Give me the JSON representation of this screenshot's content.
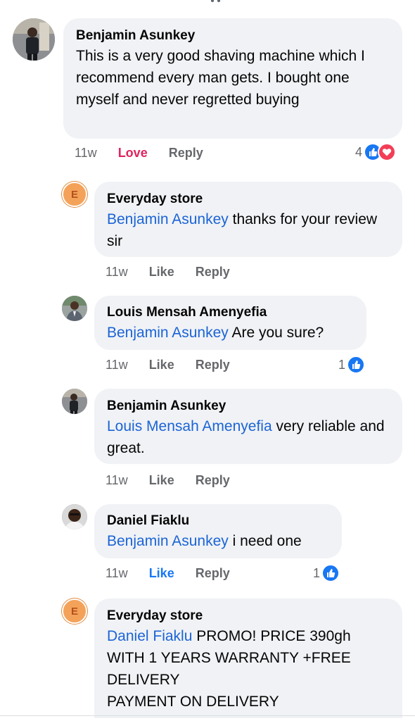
{
  "comments": [
    {
      "author": "Benjamin Asunkey",
      "mention": "",
      "text": "This is a very good shaving machine which I recommend every man gets. I bought one myself and never regretted buying",
      "time": "11w",
      "reaction_label": "Love",
      "reply_label": "Reply",
      "reaction_count": "4",
      "avatar": "photo"
    },
    {
      "author": "Everyday store",
      "mention": "Benjamin Asunkey",
      "text": " thanks for your review sir",
      "time": "11w",
      "reaction_label": "Like",
      "reply_label": "Reply",
      "reaction_count": "",
      "avatar_letter": "E"
    },
    {
      "author": "Louis Mensah Amenyefia",
      "mention": "Benjamin Asunkey",
      "text": " Are you sure?",
      "time": "11w",
      "reaction_label": "Like",
      "reply_label": "Reply",
      "reaction_count": "1",
      "avatar": "photo"
    },
    {
      "author": "Benjamin Asunkey",
      "mention": "Louis Mensah Amenyefia",
      "text": " very reliable and great.",
      "time": "11w",
      "reaction_label": "Like",
      "reply_label": "Reply",
      "reaction_count": "",
      "avatar": "photo"
    },
    {
      "author": "Daniel Fiaklu",
      "mention": "Benjamin Asunkey",
      "text": " i need one",
      "time": "11w",
      "reaction_label": "Like",
      "reply_label": "Reply",
      "reaction_count": "1",
      "avatar": "photo"
    },
    {
      "author": "Everyday store",
      "mention": "Daniel Fiaklu",
      "text": " PROMO! PRICE 390gh",
      "text_lines": [
        "WITH 1 YEARS WARRANTY +FREE",
        "DELIVERY",
        "PAYMENT ON DELIVERY"
      ],
      "avatar_letter": "E"
    }
  ],
  "colors": {
    "mention": "#1b64d6",
    "love": "#e0245e",
    "like_active": "#1877f2",
    "bubble": "#f0f2f5",
    "meta": "#65676b"
  },
  "icons": [
    "like-icon",
    "love-icon"
  ]
}
